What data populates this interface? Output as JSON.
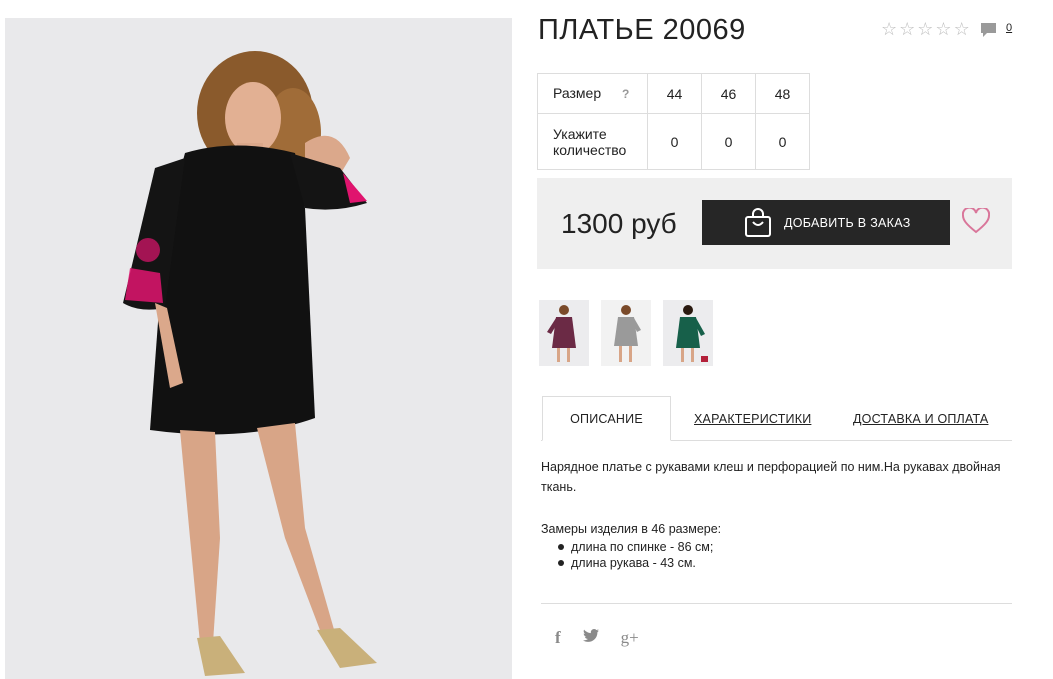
{
  "product": {
    "title": "ПЛАТЬЕ 20069",
    "rating_stars": 5,
    "comments_count": "0"
  },
  "size_table": {
    "size_label": "Размер",
    "help": "?",
    "sizes": [
      "44",
      "46",
      "48"
    ],
    "qty_label_1": "Укажите",
    "qty_label_2": "количество",
    "quantities": [
      "0",
      "0",
      "0"
    ]
  },
  "purchase": {
    "price": "1300 руб",
    "add_to_order": "ДОБАВИТЬ В ЗАКАЗ"
  },
  "thumbnails": [
    {
      "color": "#6b2a45"
    },
    {
      "color": "#9a9a9a"
    },
    {
      "color": "#17604a"
    }
  ],
  "tabs": {
    "description": "ОПИСАНИЕ",
    "characteristics": "ХАРАКТЕРИСТИКИ",
    "delivery": "ДОСТАВКА И ОПЛАТА"
  },
  "description": {
    "text": "Нарядное платье с рукавами клеш и перфорацией по ним.На рукавах двойная ткань.",
    "measurements_title": "Замеры изделия в 46 размере:",
    "measurements": [
      "длина по спинке - 86 см;",
      "длина рукава - 43 см."
    ]
  },
  "social": {
    "facebook": "f",
    "twitter": "t",
    "gplus": "g+"
  },
  "colors": {
    "button_bg": "#262626",
    "price_box_bg": "#efefef",
    "heart": "#d9769a",
    "dress": "#111111",
    "accent_pink": "#e0146e"
  }
}
